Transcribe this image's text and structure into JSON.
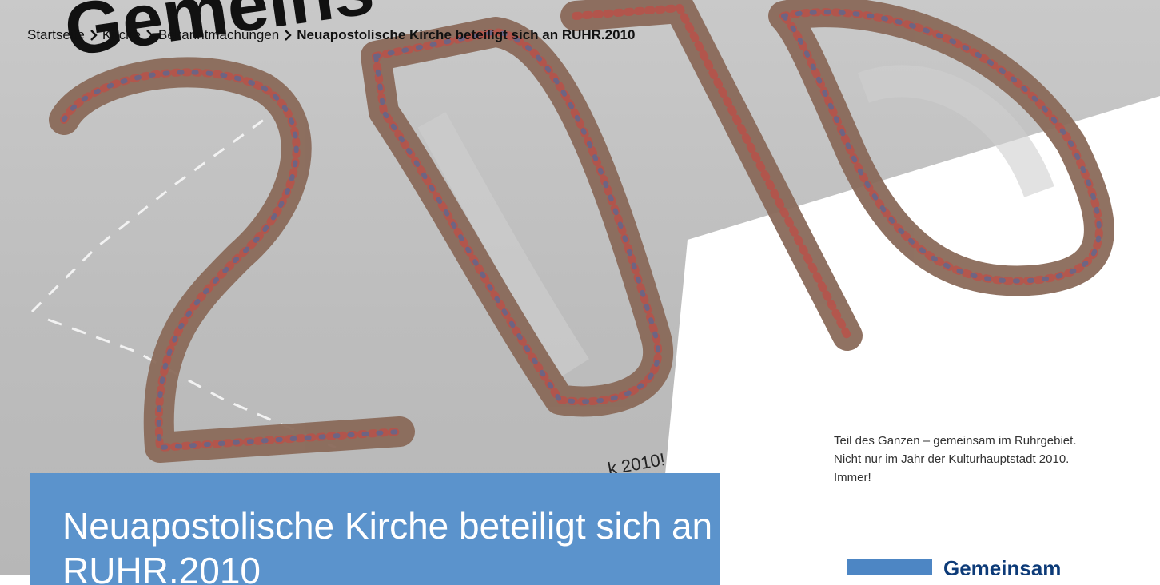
{
  "breadcrumb": {
    "items": [
      "Startseite",
      "Kirche",
      "Bekanntmachungen"
    ],
    "current": "Neuapostolische Kirche beteiligt sich an RUHR.2010"
  },
  "article": {
    "title": "Neuapostolische Kirche beteiligt sich an RUHR.2010"
  },
  "poster": {
    "headline_partial": "Gemeins",
    "number": "2010",
    "tagline_partial": "k 2010!",
    "caption_lines": [
      "Teil des Ganzen – gemeinsam im Ruhrgebiet.",
      "Nicht nur im Jahr der Kulturhauptstadt 2010.",
      "Immer!"
    ],
    "logo_word": "Gemeinsam"
  },
  "colors": {
    "title_box": "#5b93cc",
    "logo_blue": "#4d86c4",
    "breadcrumb_text": "#111111"
  }
}
